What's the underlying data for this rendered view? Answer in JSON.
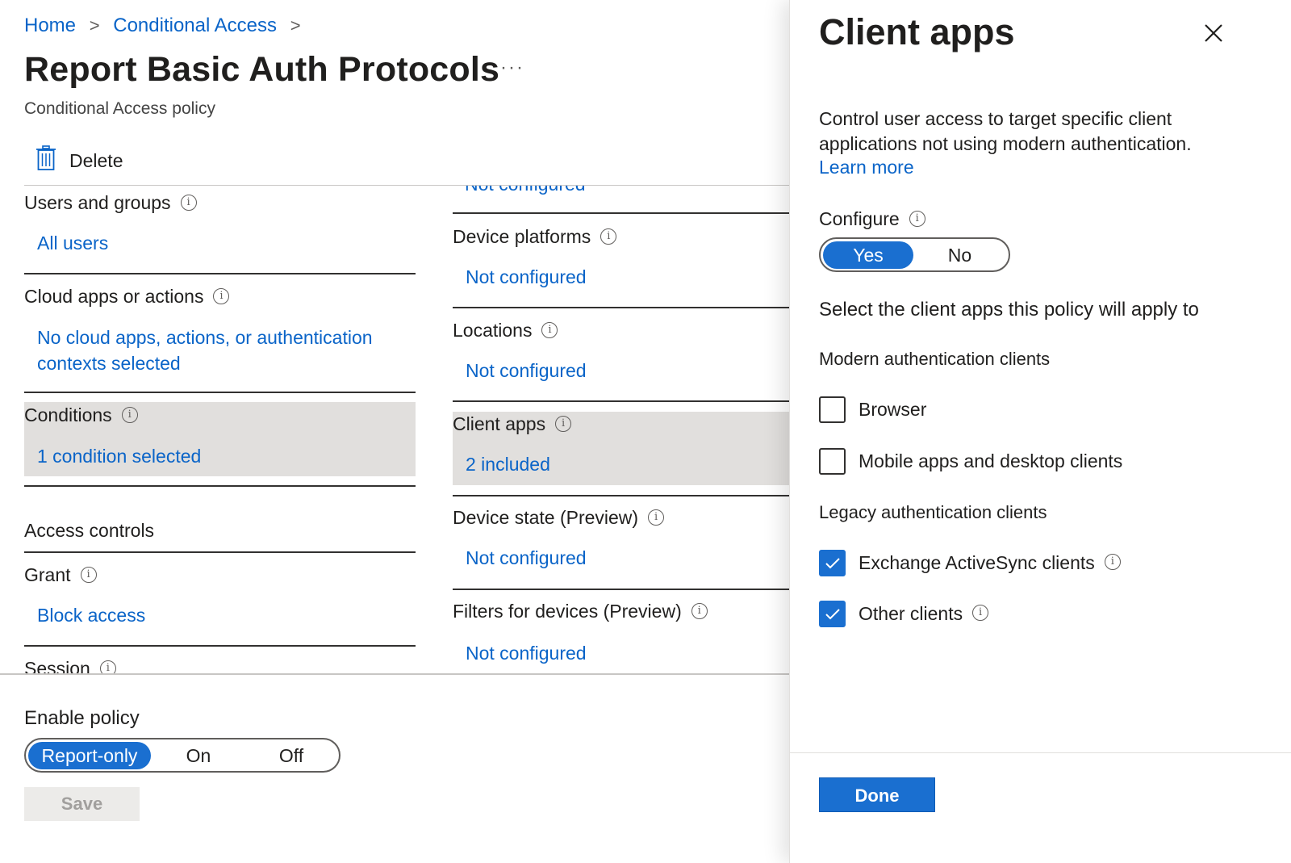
{
  "breadcrumb": {
    "home": "Home",
    "conditional_access": "Conditional Access",
    "separator": ">"
  },
  "page": {
    "title": "Report Basic Auth Protocols",
    "more": "···",
    "subtitle": "Conditional Access policy"
  },
  "toolbar": {
    "delete_label": "Delete",
    "delete_icon": "trash-icon"
  },
  "left_column": {
    "users": {
      "title": "Users and groups",
      "value": "All users"
    },
    "cloud_apps": {
      "title": "Cloud apps or actions",
      "value_line1": "No cloud apps, actions, or authentication",
      "value_line2": "contexts selected"
    },
    "conditions": {
      "title": "Conditions",
      "value": "1 condition selected"
    },
    "access_controls": "Access controls",
    "grant": {
      "title": "Grant",
      "value": "Block access"
    },
    "session": {
      "title": "Session"
    }
  },
  "right_column": {
    "cut_value": "Not configured",
    "device_platforms": {
      "title": "Device platforms",
      "value": "Not configured"
    },
    "locations": {
      "title": "Locations",
      "value": "Not configured"
    },
    "client_apps": {
      "title": "Client apps",
      "value": "2 included"
    },
    "device_state": {
      "title": "Device state (Preview)",
      "value": "Not configured"
    },
    "filters": {
      "title": "Filters for devices (Preview)",
      "value": "Not configured"
    }
  },
  "enable_policy": {
    "label": "Enable policy",
    "options": [
      "Report-only",
      "On",
      "Off"
    ],
    "selected": "Report-only",
    "save_label": "Save"
  },
  "panel": {
    "title": "Client apps",
    "description": "Control user access to target specific client applications not using modern authentication.",
    "learn_more": "Learn more",
    "configure_label": "Configure",
    "configure_options": [
      "Yes",
      "No"
    ],
    "configure_selected": "Yes",
    "select_label": "Select the client apps this policy will apply to",
    "modern_label": "Modern authentication clients",
    "modern_items": [
      {
        "label": "Browser",
        "checked": false
      },
      {
        "label": "Mobile apps and desktop clients",
        "checked": false
      }
    ],
    "legacy_label": "Legacy authentication clients",
    "legacy_items": [
      {
        "label": "Exchange ActiveSync clients",
        "checked": true
      },
      {
        "label": "Other clients",
        "checked": true
      }
    ],
    "done_label": "Done"
  },
  "colors": {
    "accent": "#1a6fd0",
    "link": "#0a64c8",
    "highlight": "#e1dfdd"
  }
}
